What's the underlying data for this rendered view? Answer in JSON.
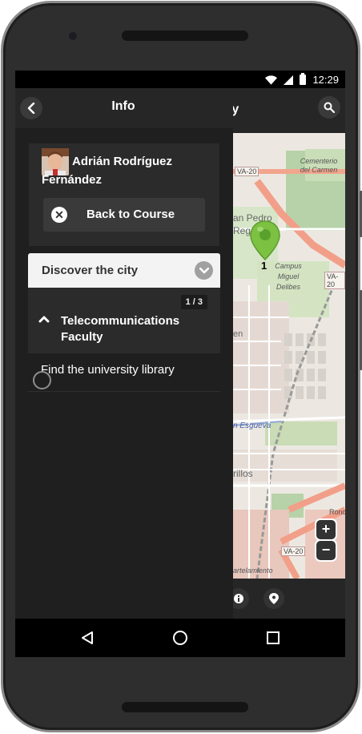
{
  "status_bar": {
    "time": "12:29"
  },
  "header": {
    "title_partial": "ty"
  },
  "panel": {
    "title": "Info",
    "user": {
      "name": "Adrián Rodríguez Fernández"
    },
    "back_to_course": "Back to Course",
    "group": {
      "title": "Discover the city",
      "item": {
        "title": "Telecommunications Faculty",
        "counter": "1 / 3"
      },
      "task": {
        "title": "Find the university library"
      }
    }
  },
  "map": {
    "labels": {
      "cemetery": "Cementerio del Carmen",
      "road_va20_top": "VA-20",
      "san_pedro": "an Pedro",
      "rega": "Rega",
      "campus": "Campus Miguel Delibes",
      "road_va20_right": "VA-20",
      "esgueva": "n Esgueva",
      "pillos": "rillos",
      "ronda": "Ronda",
      "road_va20_bottom": "VA-20",
      "partelamiento": "artelamiento",
      "en": "en"
    },
    "marker_number": "1",
    "zoom_in": "+",
    "zoom_out": "−"
  },
  "colors": {
    "marker": "#7cc142",
    "accent_dark": "#262626"
  }
}
